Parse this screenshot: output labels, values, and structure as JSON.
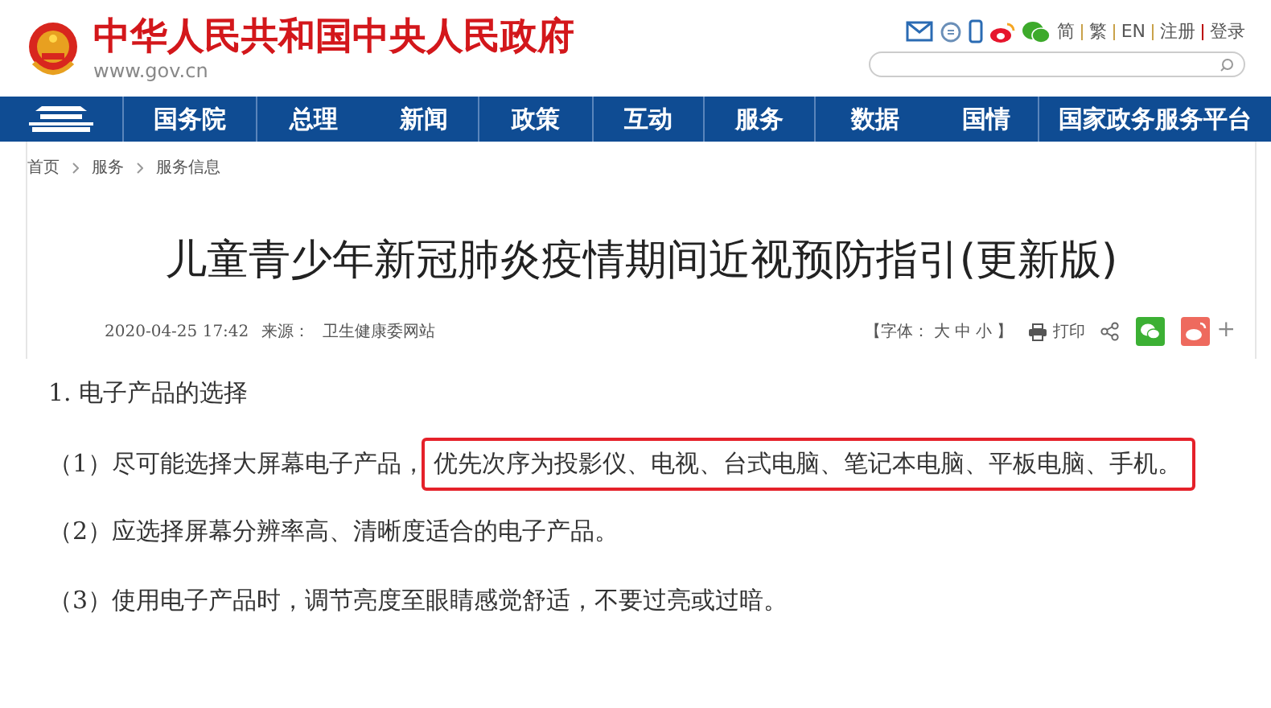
{
  "header": {
    "site_name": "中华人民共和国中央人民政府",
    "domain": "www.gov.cn",
    "links": [
      "简",
      "繁",
      "EN",
      "注册",
      "登录"
    ]
  },
  "nav": {
    "items": [
      "国务院",
      "总理",
      "新闻",
      "政策",
      "互动",
      "服务",
      "数据",
      "国情",
      "国家政务服务平台"
    ]
  },
  "breadcrumb": [
    "首页",
    "服务",
    "服务信息"
  ],
  "article": {
    "title": "儿童青少年新冠肺炎疫情期间近视预防指引(更新版)",
    "date": "2020-04-25 17:42",
    "source_label": "来源：",
    "source": "卫生健康委网站",
    "font_size": {
      "open": "【字体：",
      "sizes": [
        "大",
        "中",
        "小"
      ],
      "close": "】"
    },
    "print": "打印",
    "more": "+",
    "heading": "1. 电子产品的选择",
    "paragraphs": [
      {
        "text": "（1）尽可能选择大屏幕电子产品，",
        "highlight": "优先次序为投影仪、电视、台式电脑、笔记本电脑、平板电脑、手机。"
      },
      {
        "text": "（2）应选择屏幕分辨率高、清晰度适合的电子产品。"
      },
      {
        "text": "（3）使用电子产品时，调节亮度至眼睛感觉舒适，不要过亮或过暗。"
      }
    ]
  }
}
